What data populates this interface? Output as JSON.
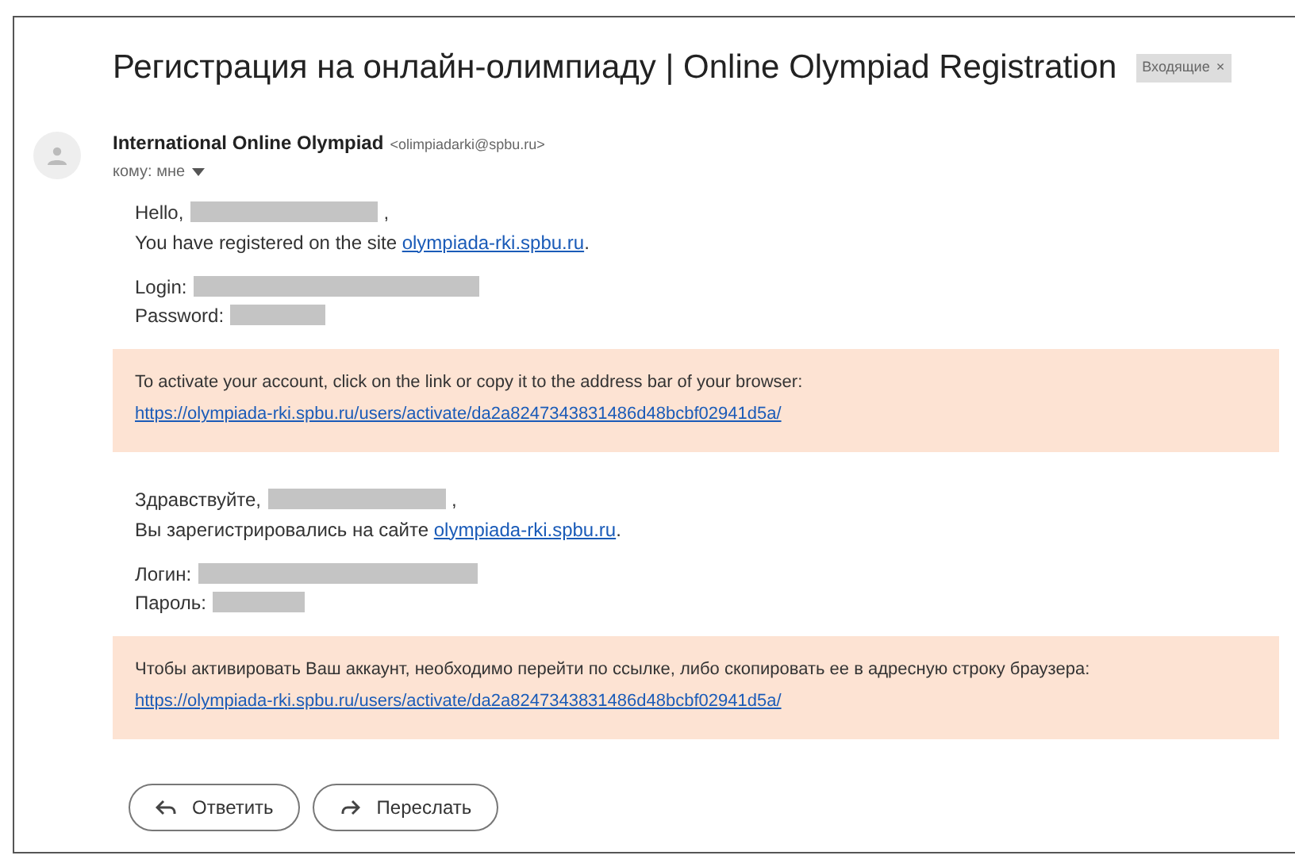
{
  "subject": "Регистрация на онлайн-олимпиаду | Online Olympiad Registration",
  "label": {
    "text": "Входящие",
    "close": "×"
  },
  "sender": {
    "name": "International Online Olympiad",
    "email": "<olimpiadarki@spbu.ru>",
    "to": "кому: мне"
  },
  "sections": [
    {
      "greeting": "Hello,",
      "greeting_end": ",",
      "registered": "You have registered on the site ",
      "site_link": "olympiada-rki.spbu.ru",
      "registered_end": ".",
      "login": "Login:",
      "password": "Password:",
      "notice": "To activate your account, click on the link or copy it to the address bar of your browser:",
      "activation_link": "https://olympiada-rki.spbu.ru/users/activate/da2a8247343831486d48bcbf02941d5a/"
    },
    {
      "greeting": "Здравствуйте,",
      "greeting_end": ",",
      "registered": "Вы зарегистрировались на сайте ",
      "site_link": "olympiada-rki.spbu.ru",
      "registered_end": ".",
      "login": "Логин:",
      "password": "Пароль:",
      "notice": "Чтобы активировать Ваш аккаунт, необходимо перейти по ссылке, либо скопировать ее в адресную строку браузера:",
      "activation_link": "https://olympiada-rki.spbu.ru/users/activate/da2a8247343831486d48bcbf02941d5a/"
    }
  ],
  "actions": [
    {
      "kind": "reply",
      "label": "Ответить"
    },
    {
      "kind": "forward",
      "label": "Переслать"
    }
  ]
}
